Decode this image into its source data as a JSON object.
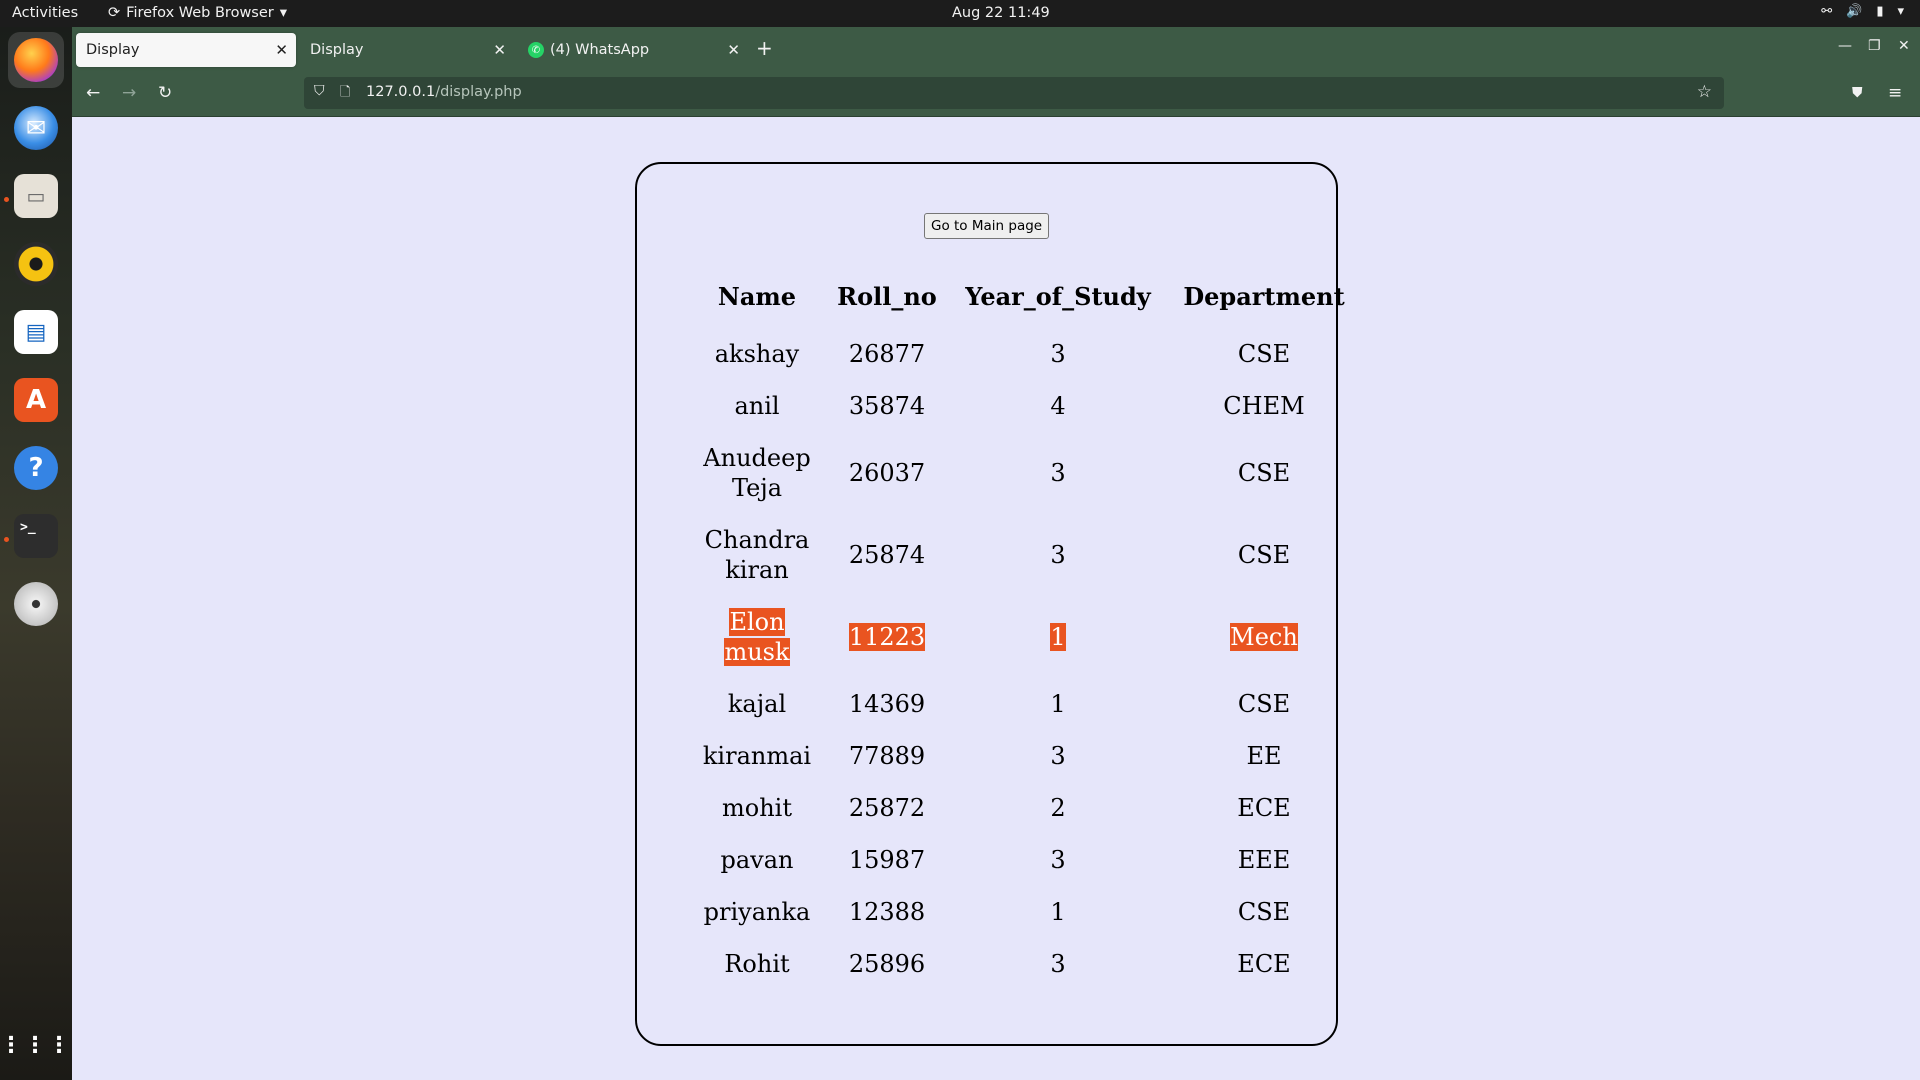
{
  "topbar": {
    "activities": "Activities",
    "app_name": "Firefox Web Browser",
    "clock": "Aug 22  11:49"
  },
  "browser": {
    "tabs": [
      {
        "label": "Display",
        "active": true
      },
      {
        "label": "Display",
        "active": false
      },
      {
        "label": "(4) WhatsApp",
        "active": false
      }
    ],
    "url_host": "127.0.0.1",
    "url_path": "/display.php"
  },
  "page": {
    "main_button": "Go to Main page",
    "table": {
      "headers": [
        "Name",
        "Roll_no",
        "Year_of_Study",
        "Department"
      ],
      "rows": [
        {
          "name": "akshay",
          "roll": "26877",
          "year": "3",
          "dept": "CSE"
        },
        {
          "name": "anil",
          "roll": "35874",
          "year": "4",
          "dept": "CHEM"
        },
        {
          "name": "Anudeep Teja",
          "roll": "26037",
          "year": "3",
          "dept": "CSE"
        },
        {
          "name": "Chandra kiran",
          "roll": "25874",
          "year": "3",
          "dept": "CSE"
        },
        {
          "name": "Elon musk",
          "roll": "11223",
          "year": "1",
          "dept": "Mech"
        },
        {
          "name": "kajal",
          "roll": "14369",
          "year": "1",
          "dept": "CSE"
        },
        {
          "name": "kiranmai",
          "roll": "77889",
          "year": "3",
          "dept": "EE"
        },
        {
          "name": "mohit",
          "roll": "25872",
          "year": "2",
          "dept": "ECE"
        },
        {
          "name": "pavan",
          "roll": "15987",
          "year": "3",
          "dept": "EEE"
        },
        {
          "name": "priyanka",
          "roll": "12388",
          "year": "1",
          "dept": "CSE"
        },
        {
          "name": "Rohit",
          "roll": "25896",
          "year": "3",
          "dept": "ECE"
        }
      ]
    }
  },
  "colors": {
    "accent": "#e95420",
    "browser_chrome": "#3d5a45",
    "page_background": "#e6e6fa"
  }
}
